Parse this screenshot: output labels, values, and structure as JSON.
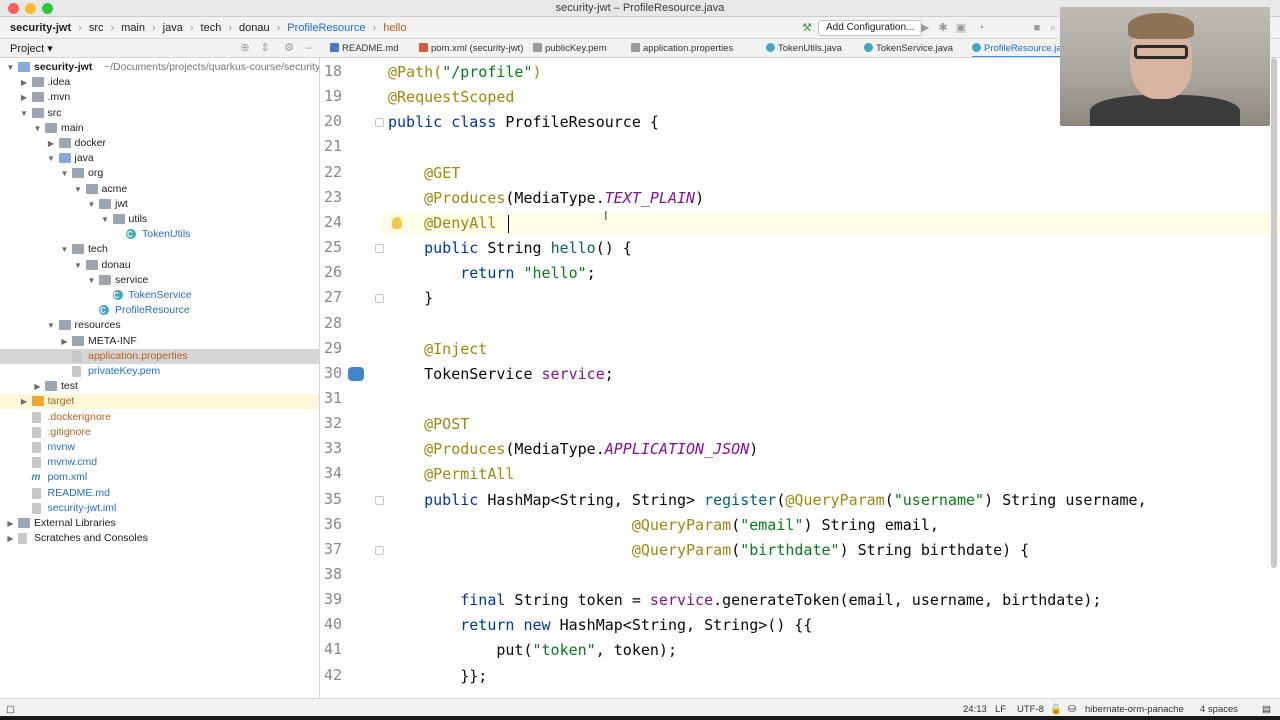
{
  "window": {
    "title": "security-jwt – ProfileResource.java"
  },
  "breadcrumbs": [
    "security-jwt",
    "src",
    "main",
    "java",
    "tech",
    "donau",
    "ProfileResource",
    "hello"
  ],
  "toolbar": {
    "add_config": "Add Configuration..."
  },
  "project_panel": {
    "label": "Project"
  },
  "tabs": [
    {
      "label": "README.md",
      "color": "#4a7bc4"
    },
    {
      "label": "pom.xml (security-jwt)",
      "color": "#d35a3a"
    },
    {
      "label": "publicKey.pem",
      "color": "#9a9a9a"
    },
    {
      "label": "application.properties",
      "color": "#9a9a9a"
    },
    {
      "label": "TokenUtils.java",
      "color": "#3fa7c4"
    },
    {
      "label": "TokenService.java",
      "color": "#3fa7c4"
    },
    {
      "label": "ProfileResource.java",
      "color": "#3fa7c4"
    }
  ],
  "tree": [
    {
      "label": "security-jwt",
      "path": "~/Documents/projects/quarkus-course/security-",
      "indent": 0,
      "arrow": "down",
      "icon": "folder-blue",
      "bold": true
    },
    {
      "label": ".idea",
      "indent": 1,
      "arrow": "right",
      "icon": "folder"
    },
    {
      "label": ".mvn",
      "indent": 1,
      "arrow": "right",
      "icon": "folder"
    },
    {
      "label": "src",
      "indent": 1,
      "arrow": "down",
      "icon": "folder"
    },
    {
      "label": "main",
      "indent": 2,
      "arrow": "down",
      "icon": "folder"
    },
    {
      "label": "docker",
      "indent": 3,
      "arrow": "right",
      "icon": "folder"
    },
    {
      "label": "java",
      "indent": 3,
      "arrow": "down",
      "icon": "folder-blue"
    },
    {
      "label": "org",
      "indent": 4,
      "arrow": "down",
      "icon": "folder"
    },
    {
      "label": "acme",
      "indent": 5,
      "arrow": "down",
      "icon": "folder"
    },
    {
      "label": "jwt",
      "indent": 6,
      "arrow": "down",
      "icon": "folder"
    },
    {
      "label": "utils",
      "indent": 7,
      "arrow": "down",
      "icon": "folder"
    },
    {
      "label": "TokenUtils",
      "indent": 8,
      "arrow": "",
      "icon": "class",
      "color": "#1f6fcf"
    },
    {
      "label": "tech",
      "indent": 4,
      "arrow": "down",
      "icon": "folder"
    },
    {
      "label": "donau",
      "indent": 5,
      "arrow": "down",
      "icon": "folder"
    },
    {
      "label": "service",
      "indent": 6,
      "arrow": "down",
      "icon": "folder"
    },
    {
      "label": "TokenService",
      "indent": 7,
      "arrow": "",
      "icon": "class",
      "color": "#1f6fcf"
    },
    {
      "label": "ProfileResource",
      "indent": 6,
      "arrow": "",
      "icon": "class",
      "color": "#1f6fcf"
    },
    {
      "label": "resources",
      "indent": 3,
      "arrow": "down",
      "icon": "folder"
    },
    {
      "label": "META-INF",
      "indent": 4,
      "arrow": "right",
      "icon": "folder"
    },
    {
      "label": "application.properties",
      "indent": 4,
      "arrow": "",
      "icon": "file",
      "color": "#b5631b",
      "selected": true
    },
    {
      "label": "privateKey.pem",
      "indent": 4,
      "arrow": "",
      "icon": "file",
      "color": "#1f6fcf"
    },
    {
      "label": "test",
      "indent": 2,
      "arrow": "right",
      "icon": "folder"
    },
    {
      "label": "target",
      "indent": 1,
      "arrow": "right",
      "icon": "folder-orange",
      "color": "#b5631b",
      "highlight": true
    },
    {
      "label": ".dockerignore",
      "indent": 1,
      "arrow": "",
      "icon": "file",
      "color": "#b5631b"
    },
    {
      "label": ".gitignore",
      "indent": 1,
      "arrow": "",
      "icon": "file",
      "color": "#b5631b"
    },
    {
      "label": "mvnw",
      "indent": 1,
      "arrow": "",
      "icon": "file",
      "color": "#1f6fcf"
    },
    {
      "label": "mvnw.cmd",
      "indent": 1,
      "arrow": "",
      "icon": "file",
      "color": "#1f6fcf"
    },
    {
      "label": "pom.xml",
      "indent": 1,
      "arrow": "",
      "icon": "m",
      "color": "#1f6fcf"
    },
    {
      "label": "README.md",
      "indent": 1,
      "arrow": "",
      "icon": "file",
      "color": "#1f6fcf"
    },
    {
      "label": "security-jwt.iml",
      "indent": 1,
      "arrow": "",
      "icon": "file",
      "color": "#1f6fcf"
    },
    {
      "label": "External Libraries",
      "indent": 0,
      "arrow": "right",
      "icon": "lib"
    },
    {
      "label": "Scratches and Consoles",
      "indent": 0,
      "arrow": "right",
      "icon": "scratch"
    }
  ],
  "code": {
    "current_line": 24,
    "lines": [
      {
        "n": "18",
        "html": "<span class=\"ann\">@Path(</span><span class=\"str\">\"/profile\"</span><span class=\"ann\">)</span>"
      },
      {
        "n": "19",
        "html": "<span class=\"ann\">@RequestScoped</span>"
      },
      {
        "n": "20",
        "html": "<span class=\"kw\">public class</span> ProfileResource {"
      },
      {
        "n": "21",
        "html": ""
      },
      {
        "n": "22",
        "html": "    <span class=\"ann\">@GET</span>"
      },
      {
        "n": "23",
        "html": "    <span class=\"ann\">@Produces</span>(MediaType.<span class=\"cst\">TEXT_PLAIN</span>)"
      },
      {
        "n": "24",
        "html": "    <span class=\"ann\">@DenyAll</span>"
      },
      {
        "n": "25",
        "html": "    <span class=\"kw\">public</span> String <span class=\"mth\">hello</span>() {"
      },
      {
        "n": "26",
        "html": "        <span class=\"kw\">return</span> <span class=\"str\">\"hello\"</span>;"
      },
      {
        "n": "27",
        "html": "    }"
      },
      {
        "n": "28",
        "html": ""
      },
      {
        "n": "29",
        "html": "    <span class=\"ann\">@Inject</span>"
      },
      {
        "n": "30",
        "html": "    TokenService <span class=\"fld\">service</span>;"
      },
      {
        "n": "31",
        "html": ""
      },
      {
        "n": "32",
        "html": "    <span class=\"ann\">@POST</span>"
      },
      {
        "n": "33",
        "html": "    <span class=\"ann\">@Produces</span>(MediaType.<span class=\"cst\">APPLICATION_JSON</span>)"
      },
      {
        "n": "34",
        "html": "    <span class=\"ann\">@PermitAll</span>"
      },
      {
        "n": "35",
        "html": "    <span class=\"kw\">public</span> HashMap&lt;String, String&gt; <span class=\"mth\">register</span>(<span class=\"ann\">@QueryParam</span>(<span class=\"str\">\"username\"</span>) String username,"
      },
      {
        "n": "36",
        "html": "                           <span class=\"ann\">@QueryParam</span>(<span class=\"str\">\"email\"</span>) String email,"
      },
      {
        "n": "37",
        "html": "                           <span class=\"ann\">@QueryParam</span>(<span class=\"str\">\"birthdate\"</span>) String birthdate) {"
      },
      {
        "n": "38",
        "html": ""
      },
      {
        "n": "39",
        "html": "        <span class=\"kw\">final</span> String token = <span class=\"fld\">service</span>.generateToken(email, username, birthdate);"
      },
      {
        "n": "40",
        "html": "        <span class=\"kw\">return new</span> HashMap&lt;String, String&gt;() {{"
      },
      {
        "n": "41",
        "html": "            put(<span class=\"str\">\"token\"</span>, token);"
      },
      {
        "n": "42",
        "html": "        }};"
      }
    ]
  },
  "statusbar": {
    "position": "24:13",
    "line_sep": "LF",
    "encoding": "UTF-8",
    "context": "hibernate-orm-panache",
    "indent": "4 spaces"
  }
}
